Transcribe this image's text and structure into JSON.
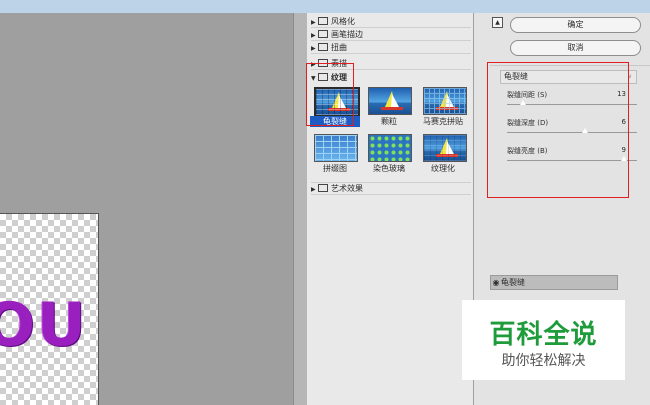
{
  "filter_gallery": {
    "categories": [
      {
        "label": "风格化",
        "expanded": false
      },
      {
        "label": "画笔描边",
        "expanded": false
      },
      {
        "label": "扭曲",
        "expanded": false
      },
      {
        "label": "素描",
        "expanded": false
      },
      {
        "label": "纹理",
        "expanded": true
      },
      {
        "label": "艺术效果",
        "expanded": false
      }
    ],
    "texture_filters": [
      {
        "label": "龟裂缝",
        "selected": true
      },
      {
        "label": "颗粒",
        "selected": false
      },
      {
        "label": "马赛克拼贴",
        "selected": false
      },
      {
        "label": "拼缀图",
        "selected": false
      },
      {
        "label": "染色玻璃",
        "selected": false
      },
      {
        "label": "纹理化",
        "selected": false
      }
    ]
  },
  "buttons": {
    "ok": "确定",
    "cancel": "取消"
  },
  "settings": {
    "filter_select": "龟裂缝",
    "params": [
      {
        "label": "裂缝间距 (S)",
        "value": "13",
        "slider_fraction": 0.12
      },
      {
        "label": "裂缝深度 (D)",
        "value": "6",
        "slider_fraction": 0.6
      },
      {
        "label": "裂缝亮度 (B)",
        "value": "9",
        "slider_fraction": 0.9
      }
    ]
  },
  "effect_layers": [
    {
      "label": "龟裂缝"
    }
  ],
  "canvas": {
    "text": "OU"
  },
  "watermark": {
    "title": "百科全说",
    "subtitle": "助你轻松解决"
  },
  "colors": {
    "selection_highlight": "#1e5cc4",
    "annotation_red": "#e02020",
    "watermark_green": "#1e9b3a",
    "text_purple": "#9a1fbf"
  }
}
